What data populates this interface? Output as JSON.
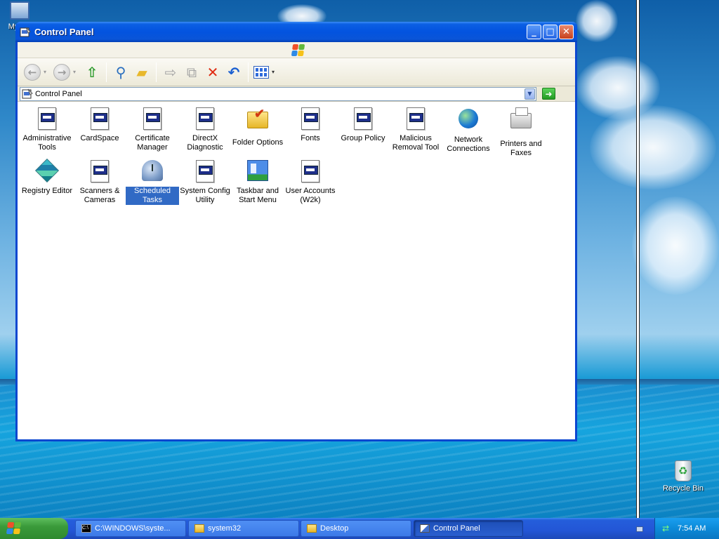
{
  "desktop": {
    "icons": [
      {
        "label": "My"
      },
      {
        "label": "Recycle Bin"
      }
    ]
  },
  "window": {
    "title": "Control Panel",
    "buttons": {
      "minimize": "_",
      "maximize": "□",
      "close": "✕"
    },
    "address": {
      "label": "Control Panel"
    },
    "items": [
      {
        "label": "Administrative Tools",
        "icon": "admin-tools-icon",
        "selected": false
      },
      {
        "label": "CardSpace",
        "icon": "cardspace-icon",
        "selected": false
      },
      {
        "label": "Certificate Manager",
        "icon": "certificate-icon",
        "selected": false
      },
      {
        "label": "DirectX Diagnostic",
        "icon": "directx-icon",
        "selected": false
      },
      {
        "label": "Folder Options",
        "icon": "folder-options-icon",
        "selected": false
      },
      {
        "label": "Fonts",
        "icon": "fonts-icon",
        "selected": false
      },
      {
        "label": "Group Policy",
        "icon": "group-policy-icon",
        "selected": false
      },
      {
        "label": "Malicious Removal Tool",
        "icon": "removal-tool-icon",
        "selected": false
      },
      {
        "label": "Network Connections",
        "icon": "network-icon",
        "selected": false
      },
      {
        "label": "Printers and Faxes",
        "icon": "printer-icon",
        "selected": false
      },
      {
        "label": "Registry Editor",
        "icon": "registry-icon",
        "selected": false
      },
      {
        "label": "Scanners & Cameras",
        "icon": "scanner-icon",
        "selected": false
      },
      {
        "label": "Scheduled Tasks",
        "icon": "scheduled-tasks-icon",
        "selected": true
      },
      {
        "label": "System Config Utility",
        "icon": "sysconfig-icon",
        "selected": false
      },
      {
        "label": "Taskbar and Start Menu",
        "icon": "taskbar-icon",
        "selected": false
      },
      {
        "label": "User Accounts (W2k)",
        "icon": "user-accounts-icon",
        "selected": false
      }
    ]
  },
  "taskbar": {
    "tasks": [
      {
        "label": "C:\\WINDOWS\\syste...",
        "icon": "cmd-icon"
      },
      {
        "label": "system32",
        "icon": "folder-icon"
      },
      {
        "label": "Desktop",
        "icon": "folder-icon"
      },
      {
        "label": "Control Panel",
        "icon": "control-panel-icon"
      }
    ],
    "clock": "7:54 AM"
  },
  "colors": {
    "title_blue": "#0353df",
    "selection": "#316ac5",
    "taskbar": "#245edb",
    "start_green": "#3a9a3a"
  }
}
